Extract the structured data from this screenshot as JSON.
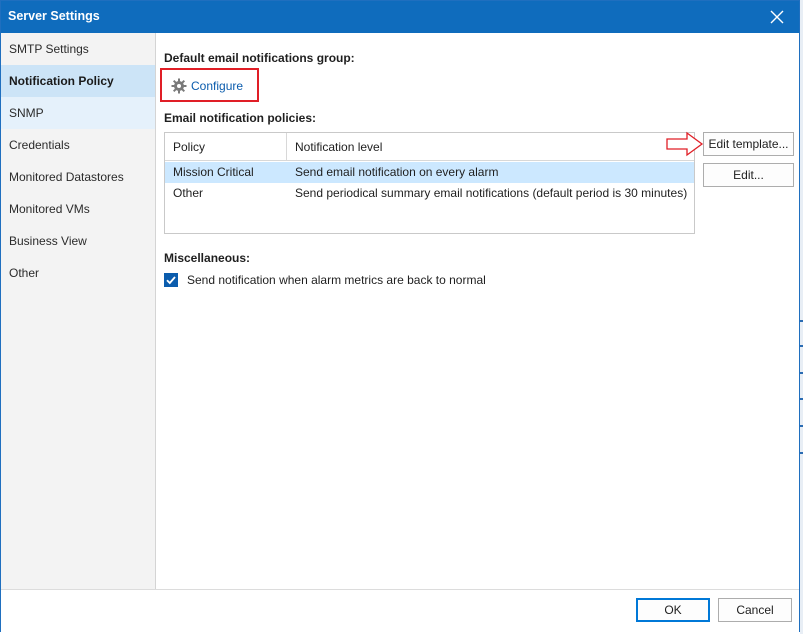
{
  "window": {
    "title": "Server Settings"
  },
  "sidebar": {
    "items": [
      {
        "label": "SMTP Settings"
      },
      {
        "label": "Notification Policy"
      },
      {
        "label": "SNMP"
      },
      {
        "label": "Credentials"
      },
      {
        "label": "Monitored Datastores"
      },
      {
        "label": "Monitored VMs"
      },
      {
        "label": "Business View"
      },
      {
        "label": "Other"
      }
    ],
    "selected_index": 1
  },
  "main": {
    "default_group_label": "Default email notifications group:",
    "configure_link": "Configure",
    "policies_label": "Email notification policies:",
    "table": {
      "columns": [
        "Policy",
        "Notification level"
      ],
      "rows": [
        {
          "policy": "Mission Critical",
          "level": "Send email notification on every alarm"
        },
        {
          "policy": "Other",
          "level": "Send periodical summary email notifications (default period is 30 minutes)"
        }
      ],
      "selected_row": 0
    },
    "edit_template_button": "Edit template...",
    "edit_button": "Edit...",
    "misc_label": "Miscellaneous:",
    "checkbox": {
      "label": "Send notification when alarm metrics are back to normal",
      "checked": true
    }
  },
  "footer": {
    "ok_label": "OK",
    "cancel_label": "Cancel"
  },
  "icons": {
    "configure": "gear-icon",
    "close": "close-icon",
    "annotation": "arrow-right-icon",
    "check": "checkmark-icon"
  },
  "colors": {
    "titlebar": "#0f6cbd",
    "selection": "#cce4f7",
    "annotation": "#e01e26",
    "link": "#0b5cad"
  }
}
